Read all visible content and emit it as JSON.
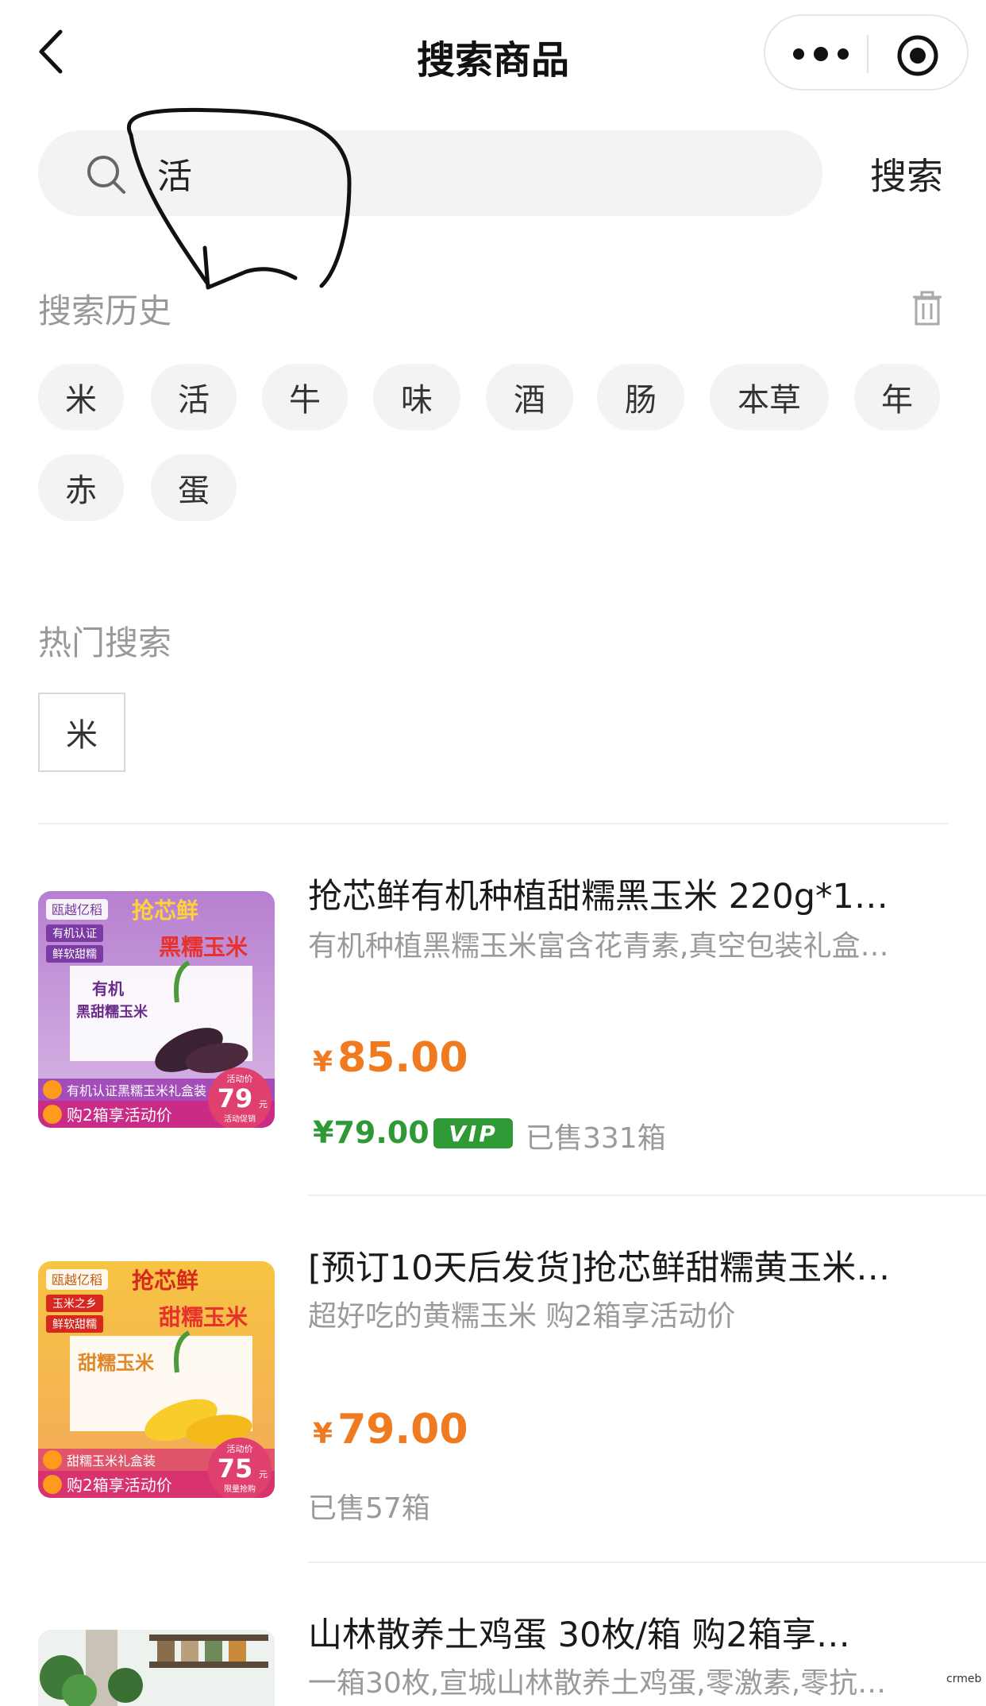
{
  "nav": {
    "title": "搜索商品"
  },
  "search": {
    "value": "活",
    "button_label": "搜索"
  },
  "history": {
    "title": "搜索历史",
    "items": [
      "米",
      "活",
      "牛",
      "味",
      "酒",
      "肠",
      "本草",
      "年",
      "赤",
      "蛋"
    ]
  },
  "hot": {
    "title": "热门搜索",
    "items": [
      "米"
    ]
  },
  "products": [
    {
      "title": "抢芯鲜有机种植甜糯黑玉米 220g*1…",
      "subtitle": "有机种植黑糯玉米富含花青素,真空包装礼盒…",
      "price_symbol": "¥",
      "price": "85.00",
      "vip_price": "¥79.00",
      "vip_label": "VIP",
      "sold": "已售331箱",
      "thumb": {
        "brand": "瓯越亿稻",
        "logo": "抢芯鲜",
        "tag1": "有机认证",
        "tag2": "鲜软甜糯",
        "headline": "黑糯玉米",
        "box_line1": "有机",
        "box_line2": "黑甜糯玉米",
        "strip1": "有机认证黑糯玉米礼盒装",
        "strip2": "购2箱享活动价",
        "deal_label": "活动价",
        "deal_price": "79",
        "deal_unit": "元",
        "deal_note": "活动促销",
        "color_top": "#9b4fb8",
        "color_bottom": "#c92b86"
      }
    },
    {
      "title": "[预订10天后发货]抢芯鲜甜糯黄玉米…",
      "subtitle": "超好吃的黄糯玉米 购2箱享活动价",
      "price_symbol": "¥",
      "price": "79.00",
      "sold": "已售57箱",
      "thumb": {
        "brand": "瓯越亿稻",
        "logo": "抢芯鲜",
        "tag1": "玉米之乡",
        "tag2": "鲜软甜糯",
        "headline": "甜糯玉米",
        "box_line1": "",
        "box_line2": "甜糯玉米",
        "strip1": "甜糯玉米礼盒装",
        "strip2": "购2箱享活动价",
        "deal_label": "活动价",
        "deal_price": "75",
        "deal_unit": "元",
        "deal_note": "限量抢购",
        "color_top": "#f2b233",
        "color_bottom": "#d8336e"
      }
    },
    {
      "title": "山林散养土鸡蛋 30枚/箱 购2箱享…",
      "subtitle": "一箱30枚,宣城山林散养土鸡蛋,零激素,零抗…"
    }
  ],
  "watermark": "crmeb"
}
